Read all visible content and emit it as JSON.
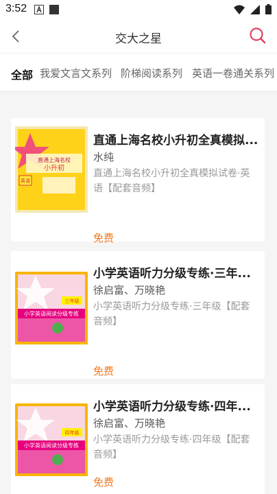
{
  "status": {
    "time": "3:52"
  },
  "header": {
    "title": "交大之星"
  },
  "tabs": [
    "全部",
    "我爱文言文系列",
    "阶梯阅读系列",
    "英语一卷通关系列"
  ],
  "books": [
    {
      "title": "直通上海名校小升初全真模拟...",
      "author": "水纯",
      "desc": "直通上海名校小升初全真模拟试卷·英语【配套音频】",
      "price": "免费",
      "cover_text": "直通上海名校 小升初 全真模拟试卷",
      "cover_badge": "英语"
    },
    {
      "title": "小学英语听力分级专练·三年...",
      "author": "徐启富、万晓艳",
      "desc": "小学英语听力分级专练·三年级【配套音频】",
      "price": "免费",
      "cover_text": "小学英语阅读分级专练",
      "cover_badge": "三年级"
    },
    {
      "title": "小学英语听力分级专练·四年...",
      "author": "徐启富、万晓艳",
      "desc": "小学英语听力分级专练·四年级【配套音频】",
      "price": "免费",
      "cover_text": "小学英语阅读分级专练",
      "cover_badge": "四年级"
    }
  ],
  "colors": {
    "accent": "#f07a22",
    "search": "#e04060"
  }
}
